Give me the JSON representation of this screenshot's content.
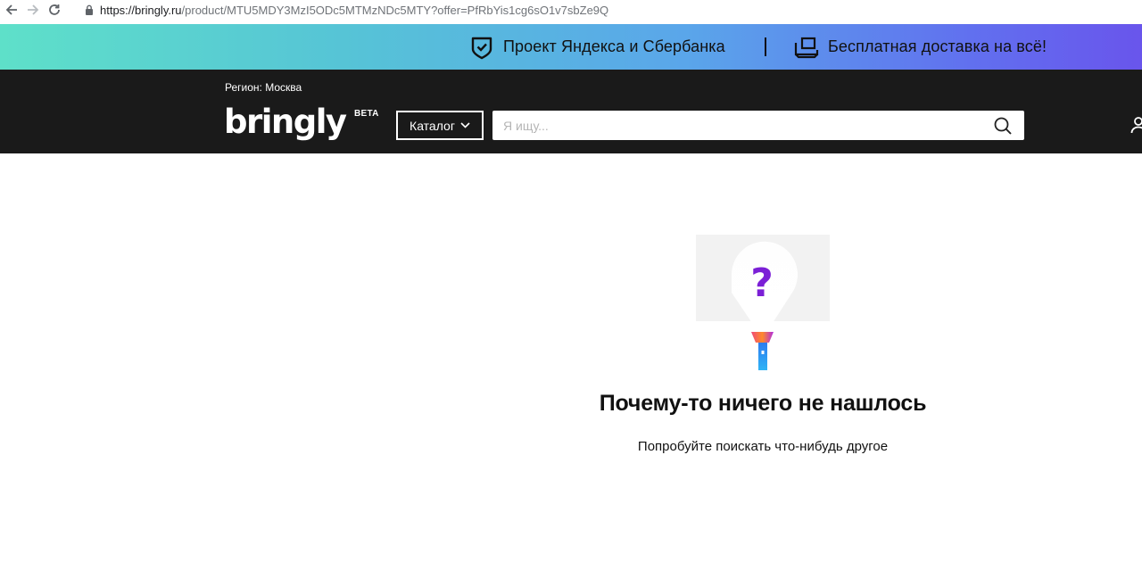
{
  "browser": {
    "url_host": "https://bringly.ru",
    "url_path": "/product/MTU5MDY3MzI5ODc5MTMzNDc5MTY?offer=PfRbYis1cg6sO1v7sbZe9Q"
  },
  "promo": {
    "project_text": "Проект Яндекса и Сбербанка",
    "delivery_text": "Бесплатная доставка на всё!",
    "gradient_start": "#5ee0c9",
    "gradient_end": "#6955ec"
  },
  "header": {
    "region_label": "Регион: Москва",
    "logo": "bringly",
    "beta": "BETA",
    "catalog_label": "Каталог",
    "search_placeholder": "Я ищу..."
  },
  "empty_state": {
    "title": "Почему-то ничего не нашлось",
    "subtitle": "Попробуйте поискать что-нибудь другое",
    "accent": "#7b1fd6"
  },
  "icons": {
    "back": "arrow-left-icon",
    "forward": "arrow-right-icon",
    "reload": "reload-icon",
    "lock": "lock-icon",
    "shield": "shield-check-icon",
    "truck": "truck-icon",
    "chevron": "chevron-down-icon",
    "search": "search-icon",
    "user": "user-icon",
    "illustration": "flashlight-question-icon"
  }
}
